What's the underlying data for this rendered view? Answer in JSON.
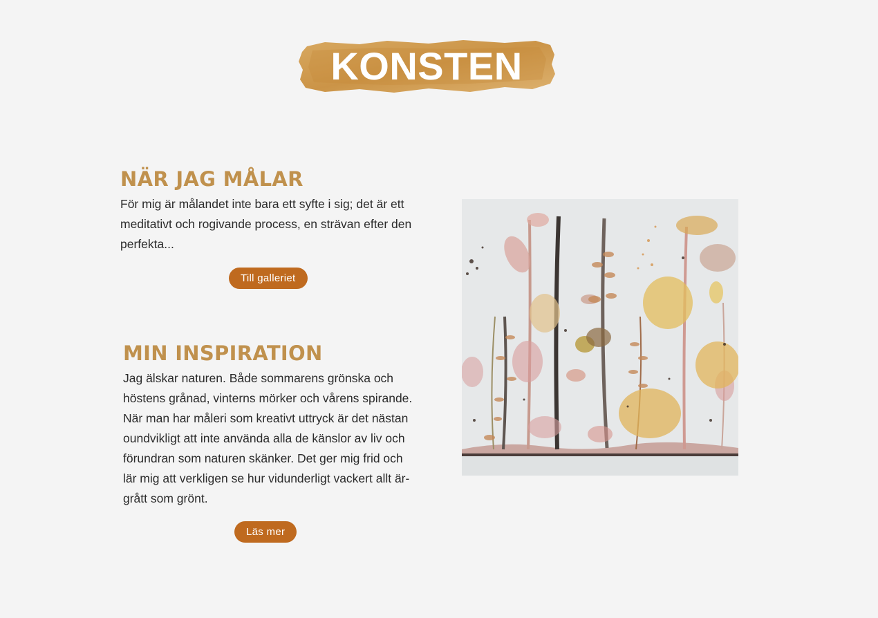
{
  "header": {
    "title": "KONSTEN",
    "brush_color": "#d09a4c"
  },
  "sections": [
    {
      "heading": "NÄR JAG MÅLAR",
      "text": "För mig är målandet inte bara ett syfte i sig; det är ett meditativt och rogivande process, en strävan efter den perfekta...",
      "button_label": "Till galleriet"
    },
    {
      "heading": "MIN INSPIRATION",
      "text": "Jag älskar naturen. Både sommarens grönska och höstens grånad, vinterns mörker och vårens spirande. När man har måleri som kreativt uttryck är det nästan oundvikligt att inte använda alla de känslor av liv och förundran som naturen skänker. Det ger mig frid och lär mig att verkligen se hur vidunderligt vackert allt är-grått som grönt.",
      "button_label": "Läs mer"
    }
  ],
  "artwork": {
    "subject": "watercolor-botanical-painting"
  },
  "colors": {
    "heading": "#c0914d",
    "button": "#bf6a1f",
    "background": "#f4f4f4"
  }
}
